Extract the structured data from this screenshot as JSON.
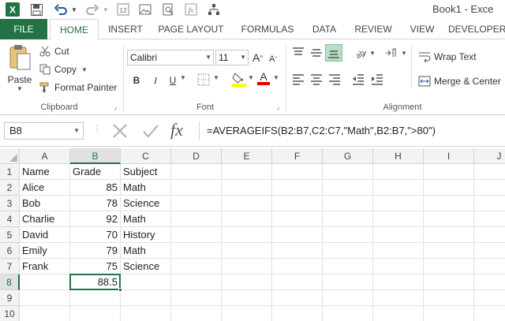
{
  "window": {
    "title": "Book1 - Exce"
  },
  "tabs": {
    "file": "FILE",
    "home": "HOME",
    "insert": "INSERT",
    "page_layout": "PAGE LAYOUT",
    "formulas": "FORMULAS",
    "data": "DATA",
    "review": "REVIEW",
    "view": "VIEW",
    "developer": "DEVELOPER"
  },
  "ribbon": {
    "clipboard": {
      "paste": "Paste",
      "cut": "Cut",
      "copy": "Copy",
      "format_painter": "Format Painter",
      "label": "Clipboard"
    },
    "font": {
      "name": "Calibri",
      "size": "11",
      "label": "Font",
      "bold": "B",
      "italic": "I",
      "underline": "U"
    },
    "alignment": {
      "wrap_text": "Wrap Text",
      "merge_center": "Merge & Center",
      "label": "Alignment"
    }
  },
  "formula_bar": {
    "name_box": "B8",
    "formula": "=AVERAGEIFS(B2:B7,C2:C7,\"Math\",B2:B7,\">80\")",
    "fx": "fx"
  },
  "columns": [
    "A",
    "B",
    "C",
    "D",
    "E",
    "F",
    "G",
    "H",
    "I",
    "J"
  ],
  "rows": [
    "1",
    "2",
    "3",
    "4",
    "5",
    "6",
    "7",
    "8",
    "9",
    "10"
  ],
  "cells": [
    [
      "Name",
      "Grade",
      "Subject"
    ],
    [
      "Alice",
      "85",
      "Math"
    ],
    [
      "Bob",
      "78",
      "Science"
    ],
    [
      "Charlie",
      "92",
      "Math"
    ],
    [
      "David",
      "70",
      "History"
    ],
    [
      "Emily",
      "79",
      "Math"
    ],
    [
      "Frank",
      "75",
      "Science"
    ],
    [
      "",
      "88.5",
      ""
    ]
  ],
  "active_cell": "B8",
  "colors": {
    "excel_green": "#217346",
    "font_color_red": "#e00000",
    "highlight_yellow": "#ffff00"
  }
}
